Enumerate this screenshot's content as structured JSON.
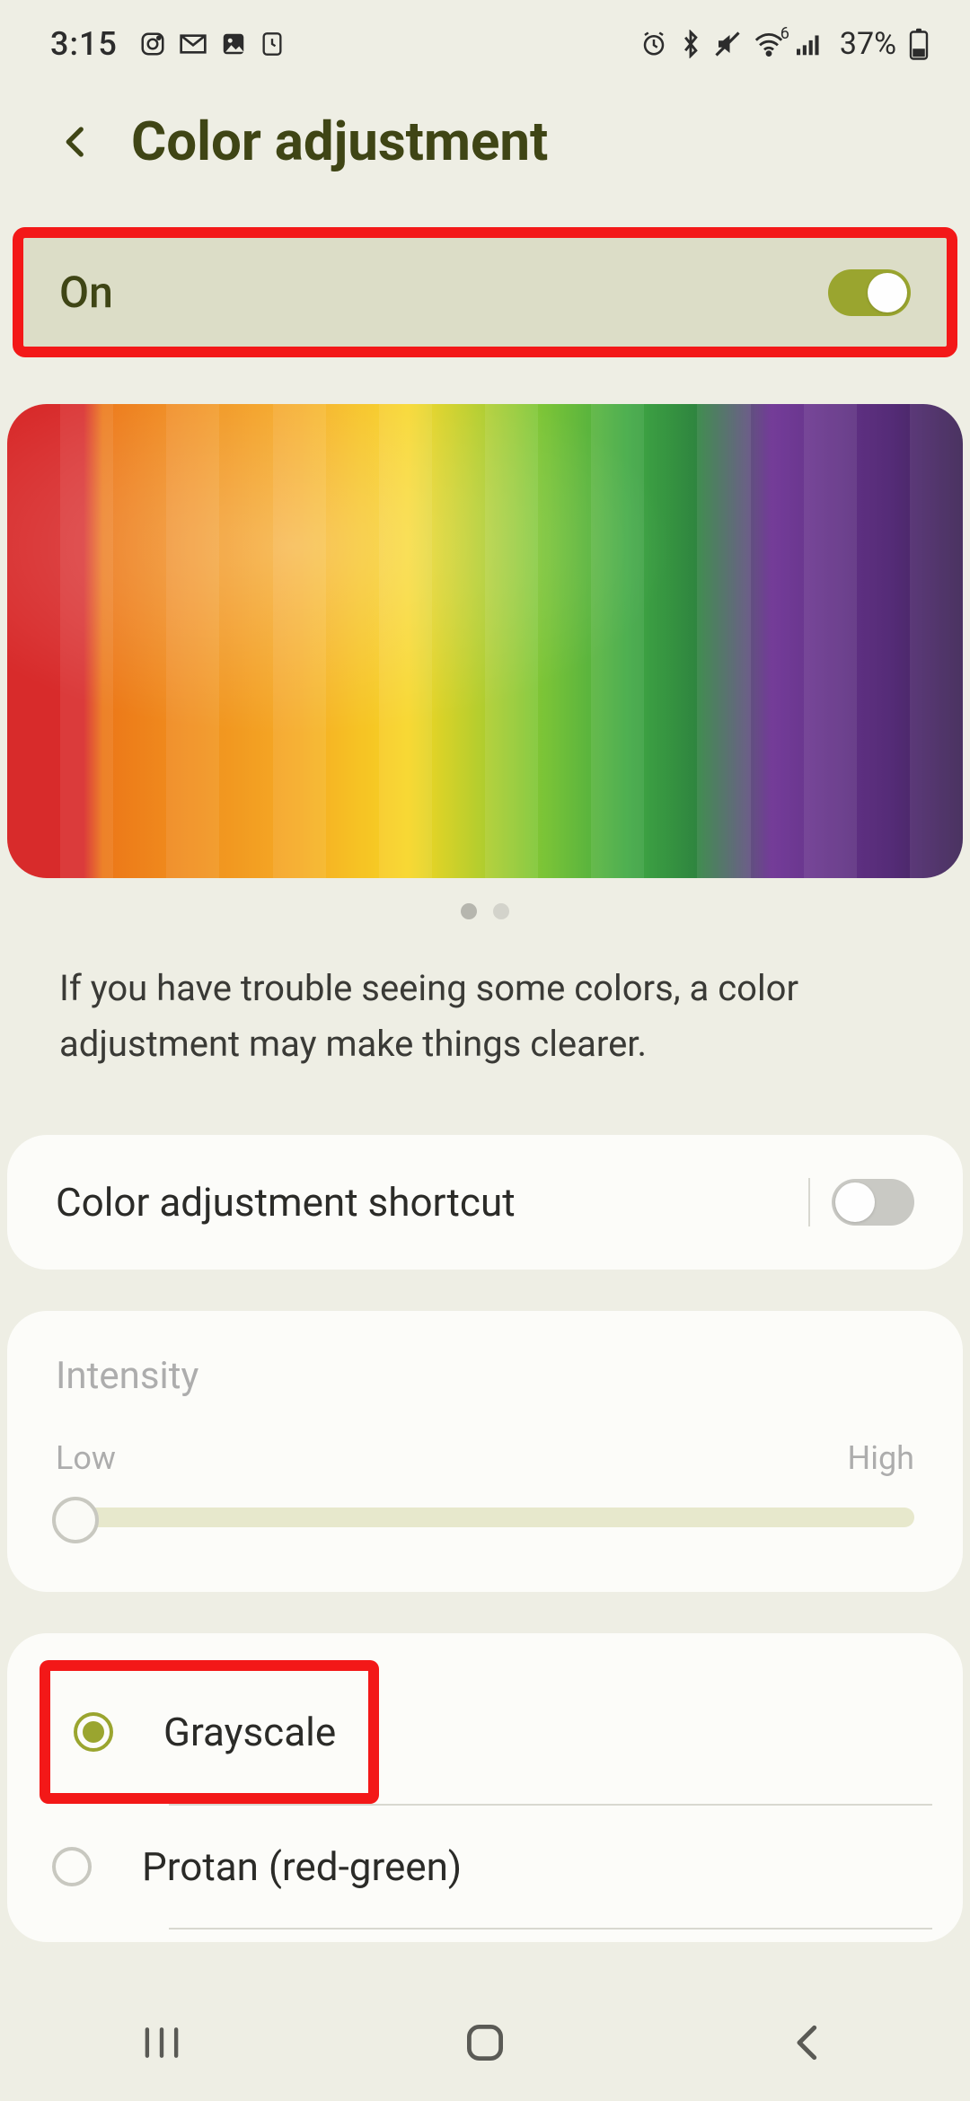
{
  "status": {
    "time": "3:15",
    "battery_percent": "37%",
    "wifi_badge": "6"
  },
  "header": {
    "title": "Color adjustment"
  },
  "toggle_row": {
    "state_label": "On"
  },
  "pager": {
    "count": 2,
    "active": 0
  },
  "description": "If you have trouble seeing some colors, a color adjustment may make things clearer.",
  "shortcut": {
    "label": "Color adjustment shortcut",
    "enabled": false
  },
  "intensity": {
    "title": "Intensity",
    "low_label": "Low",
    "high_label": "High",
    "value_percent": 0
  },
  "options": [
    {
      "label": "Grayscale",
      "selected": true
    },
    {
      "label": "Protan (red-green)",
      "selected": false
    }
  ]
}
